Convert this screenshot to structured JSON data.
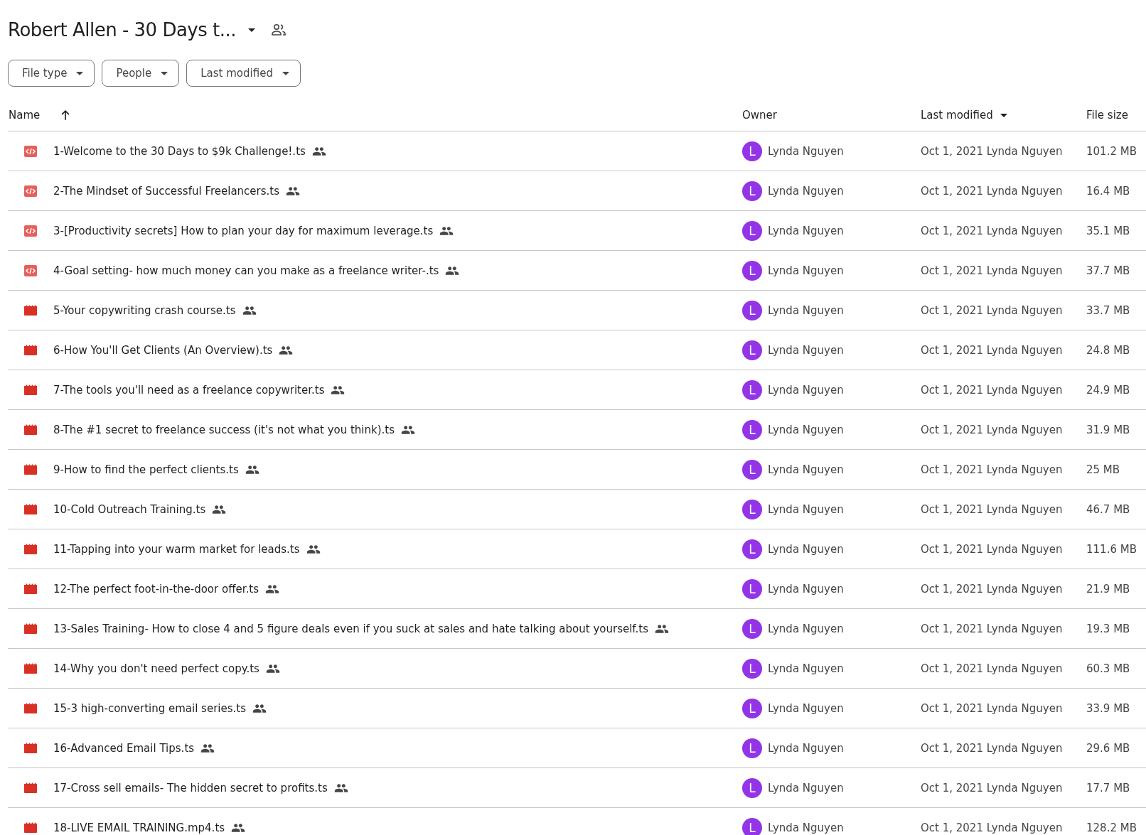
{
  "header": {
    "title": "Robert Allen - 30 Days t..."
  },
  "filters": [
    "File type",
    "People",
    "Last modified"
  ],
  "table": {
    "columns": [
      {
        "label": "Name",
        "sorted": true,
        "descending": false
      },
      {
        "label": "Owner",
        "sorted": false
      },
      {
        "label": "Last modified",
        "sorted": true,
        "descending": true
      },
      {
        "label": "File size",
        "sorted": false
      }
    ],
    "rows": [
      {
        "kind": "code",
        "name": "1-Welcome to the 30 Days to $9k Challenge!.ts",
        "owner_initial": "L",
        "owner": "Lynda Nguyen",
        "modified": "Oct 1, 2021 Lynda Nguyen",
        "size": "101.2 MB"
      },
      {
        "kind": "code",
        "name": "2-The Mindset of Successful Freelancers.ts",
        "owner_initial": "L",
        "owner": "Lynda Nguyen",
        "modified": "Oct 1, 2021 Lynda Nguyen",
        "size": "16.4 MB"
      },
      {
        "kind": "code",
        "name": "3-[Productivity secrets] How to plan your day for maximum leverage.ts",
        "owner_initial": "L",
        "owner": "Lynda Nguyen",
        "modified": "Oct 1, 2021 Lynda Nguyen",
        "size": "35.1 MB"
      },
      {
        "kind": "code",
        "name": "4-Goal setting- how much money can you make as a freelance writer-.ts",
        "owner_initial": "L",
        "owner": "Lynda Nguyen",
        "modified": "Oct 1, 2021 Lynda Nguyen",
        "size": "37.7 MB"
      },
      {
        "kind": "video",
        "name": "5-Your copywriting crash course.ts",
        "owner_initial": "L",
        "owner": "Lynda Nguyen",
        "modified": "Oct 1, 2021 Lynda Nguyen",
        "size": "33.7 MB"
      },
      {
        "kind": "video",
        "name": "6-How You'll Get Clients (An Overview).ts",
        "owner_initial": "L",
        "owner": "Lynda Nguyen",
        "modified": "Oct 1, 2021 Lynda Nguyen",
        "size": "24.8 MB"
      },
      {
        "kind": "video",
        "name": "7-The tools you'll need as a freelance copywriter.ts",
        "owner_initial": "L",
        "owner": "Lynda Nguyen",
        "modified": "Oct 1, 2021 Lynda Nguyen",
        "size": "24.9 MB"
      },
      {
        "kind": "video",
        "name": "8-The #1 secret to freelance success (it's not what you think).ts",
        "owner_initial": "L",
        "owner": "Lynda Nguyen",
        "modified": "Oct 1, 2021 Lynda Nguyen",
        "size": "31.9 MB"
      },
      {
        "kind": "video",
        "name": "9-How to find the perfect clients.ts",
        "owner_initial": "L",
        "owner": "Lynda Nguyen",
        "modified": "Oct 1, 2021 Lynda Nguyen",
        "size": "25 MB"
      },
      {
        "kind": "video",
        "name": "10-Cold Outreach Training.ts",
        "owner_initial": "L",
        "owner": "Lynda Nguyen",
        "modified": "Oct 1, 2021 Lynda Nguyen",
        "size": "46.7 MB"
      },
      {
        "kind": "video",
        "name": "11-Tapping into your warm market for leads.ts",
        "owner_initial": "L",
        "owner": "Lynda Nguyen",
        "modified": "Oct 1, 2021 Lynda Nguyen",
        "size": "111.6 MB"
      },
      {
        "kind": "video",
        "name": "12-The perfect foot-in-the-door offer.ts",
        "owner_initial": "L",
        "owner": "Lynda Nguyen",
        "modified": "Oct 1, 2021 Lynda Nguyen",
        "size": "21.9 MB"
      },
      {
        "kind": "video",
        "name": "13-Sales Training- How to close 4 and 5 figure deals even if you suck at sales and hate talking about yourself.ts",
        "owner_initial": "L",
        "owner": "Lynda Nguyen",
        "modified": "Oct 1, 2021 Lynda Nguyen",
        "size": "19.3 MB"
      },
      {
        "kind": "video",
        "name": "14-Why you don't need perfect copy.ts",
        "owner_initial": "L",
        "owner": "Lynda Nguyen",
        "modified": "Oct 1, 2021 Lynda Nguyen",
        "size": "60.3 MB"
      },
      {
        "kind": "video",
        "name": "15-3 high-converting email series.ts",
        "owner_initial": "L",
        "owner": "Lynda Nguyen",
        "modified": "Oct 1, 2021 Lynda Nguyen",
        "size": "33.9 MB"
      },
      {
        "kind": "video",
        "name": "16-Advanced Email Tips.ts",
        "owner_initial": "L",
        "owner": "Lynda Nguyen",
        "modified": "Oct 1, 2021 Lynda Nguyen",
        "size": "29.6 MB"
      },
      {
        "kind": "video",
        "name": "17-Cross sell emails- The hidden secret to profits.ts",
        "owner_initial": "L",
        "owner": "Lynda Nguyen",
        "modified": "Oct 1, 2021 Lynda Nguyen",
        "size": "17.7 MB"
      },
      {
        "kind": "video",
        "name": "18-LIVE EMAIL TRAINING.mp4.ts",
        "owner_initial": "L",
        "owner": "Lynda Nguyen",
        "modified": "Oct 1, 2021 Lynda Nguyen",
        "size": "128.2 MB"
      }
    ]
  }
}
